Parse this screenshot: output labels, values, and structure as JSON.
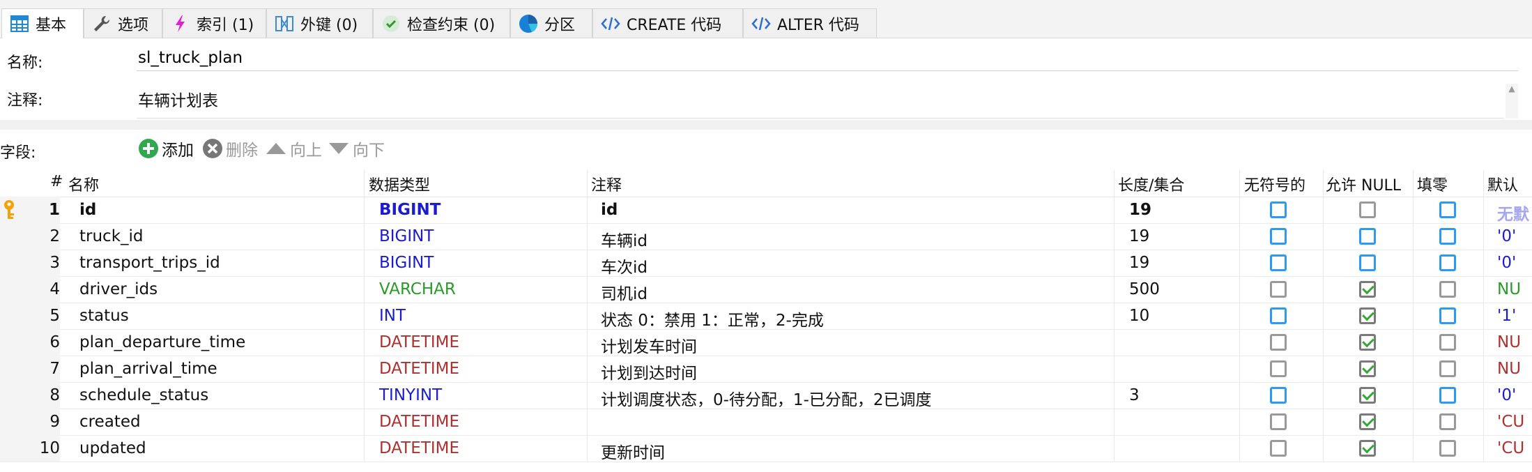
{
  "tabs": [
    {
      "label": "基本",
      "icon": "table-grid-icon",
      "active": true
    },
    {
      "label": "选项",
      "icon": "wrench-icon",
      "active": false
    },
    {
      "label": "索引 (1)",
      "icon": "lightning-icon",
      "active": false
    },
    {
      "label": "外键 (0)",
      "icon": "foreign-key-icon",
      "active": false
    },
    {
      "label": "检查约束 (0)",
      "icon": "check-circle-icon",
      "active": false
    },
    {
      "label": "分区",
      "icon": "pie-chart-icon",
      "active": false
    },
    {
      "label": "CREATE 代码",
      "icon": "code-icon",
      "active": false
    },
    {
      "label": "ALTER 代码",
      "icon": "code-icon",
      "active": false
    }
  ],
  "form": {
    "name_label": "名称:",
    "name_value": "sl_truck_plan",
    "comment_label": "注释:",
    "comment_value": "车辆计划表",
    "fields_label": "字段:"
  },
  "toolbar": {
    "add_label": "添加",
    "delete_label": "删除",
    "up_label": "向上",
    "down_label": "向下"
  },
  "table": {
    "headers": [
      "#",
      "名称",
      "数据类型",
      "注释",
      "长度/集合",
      "无符号的",
      "允许 NULL",
      "填零",
      "默认"
    ],
    "rows": [
      {
        "n": "1",
        "name": "id",
        "type": "BIGINT",
        "comment": "id",
        "length": "19",
        "unsigned": "empty",
        "null": "gray",
        "zerofill": "empty",
        "def": "无默",
        "pk": true,
        "type_color": "#1c1ccf",
        "def_color": "#a6a6ee"
      },
      {
        "n": "2",
        "name": "truck_id",
        "type": "BIGINT",
        "comment": "车辆id",
        "length": "19",
        "unsigned": "empty",
        "null": "empty",
        "zerofill": "empty",
        "def": "'0'",
        "pk": false,
        "type_color": "#1c1ccf",
        "def_color": "#1c1ccf"
      },
      {
        "n": "3",
        "name": "transport_trips_id",
        "type": "BIGINT",
        "comment": "车次id",
        "length": "19",
        "unsigned": "empty",
        "null": "empty",
        "zerofill": "empty",
        "def": "'0'",
        "pk": false,
        "type_color": "#1c1ccf",
        "def_color": "#1c1ccf"
      },
      {
        "n": "4",
        "name": "driver_ids",
        "type": "VARCHAR",
        "comment": "司机id",
        "length": "500",
        "unsigned": "gray",
        "null": "checked",
        "zerofill": "gray",
        "def": "NU",
        "pk": false,
        "type_color": "#2a9a2a",
        "def_color": "#2a9a2a"
      },
      {
        "n": "5",
        "name": "status",
        "type": "INT",
        "comment": "状态 0：禁用 1：正常，2-完成",
        "length": "10",
        "unsigned": "empty",
        "null": "checked",
        "zerofill": "empty",
        "def": "'1'",
        "pk": false,
        "type_color": "#1c1ccf",
        "def_color": "#1c1ccf"
      },
      {
        "n": "6",
        "name": "plan_departure_time",
        "type": "DATETIME",
        "comment": "计划发车时间",
        "length": "",
        "unsigned": "gray",
        "null": "checked",
        "zerofill": "gray",
        "def": "NU",
        "pk": false,
        "type_color": "#b03030",
        "def_color": "#b03030"
      },
      {
        "n": "7",
        "name": "plan_arrival_time",
        "type": "DATETIME",
        "comment": "计划到达时间",
        "length": "",
        "unsigned": "gray",
        "null": "checked",
        "zerofill": "gray",
        "def": "NU",
        "pk": false,
        "type_color": "#b03030",
        "def_color": "#b03030"
      },
      {
        "n": "8",
        "name": "schedule_status",
        "type": "TINYINT",
        "comment": "计划调度状态，0-待分配，1-已分配，2已调度",
        "length": "3",
        "unsigned": "empty",
        "null": "checked",
        "zerofill": "empty",
        "def": "'0'",
        "pk": false,
        "type_color": "#1c1ccf",
        "def_color": "#1c1ccf"
      },
      {
        "n": "9",
        "name": "created",
        "type": "DATETIME",
        "comment": "",
        "length": "",
        "unsigned": "gray",
        "null": "checked",
        "zerofill": "gray",
        "def": "'CU",
        "pk": false,
        "type_color": "#b03030",
        "def_color": "#b03030"
      },
      {
        "n": "10",
        "name": "updated",
        "type": "DATETIME",
        "comment": "更新时间",
        "length": "",
        "unsigned": "gray",
        "null": "checked",
        "zerofill": "gray",
        "def": "'CU",
        "pk": false,
        "type_color": "#b03030",
        "def_color": "#b03030"
      }
    ]
  }
}
